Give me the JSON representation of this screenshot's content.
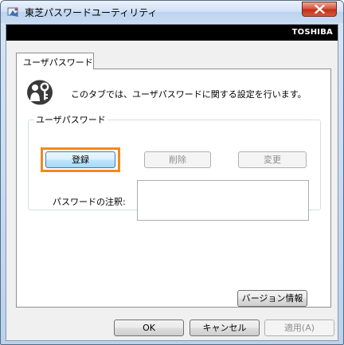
{
  "window": {
    "title": "東芝パスワードユーティリティ",
    "brand": "TOSHIBA"
  },
  "tabs": [
    {
      "label": "ユーザパスワード",
      "selected": true
    }
  ],
  "panel": {
    "description": "このタブでは、ユーザパスワードに関する設定を行います。",
    "group_label": "ユーザパスワード",
    "buttons": {
      "register": "登録",
      "delete": "削除",
      "change": "変更"
    },
    "note_label": "パスワードの注釈:",
    "note_value": "",
    "version_button": "バージョン情報"
  },
  "footer": {
    "ok": "OK",
    "cancel": "キャンセル",
    "apply": "適用(A)"
  },
  "colors": {
    "highlight": "#f08a1c",
    "brand_bar": "#000000"
  },
  "icons": {
    "title": "toshiba-utility-icon",
    "panel": "user-key-icon",
    "close": "close-icon"
  }
}
